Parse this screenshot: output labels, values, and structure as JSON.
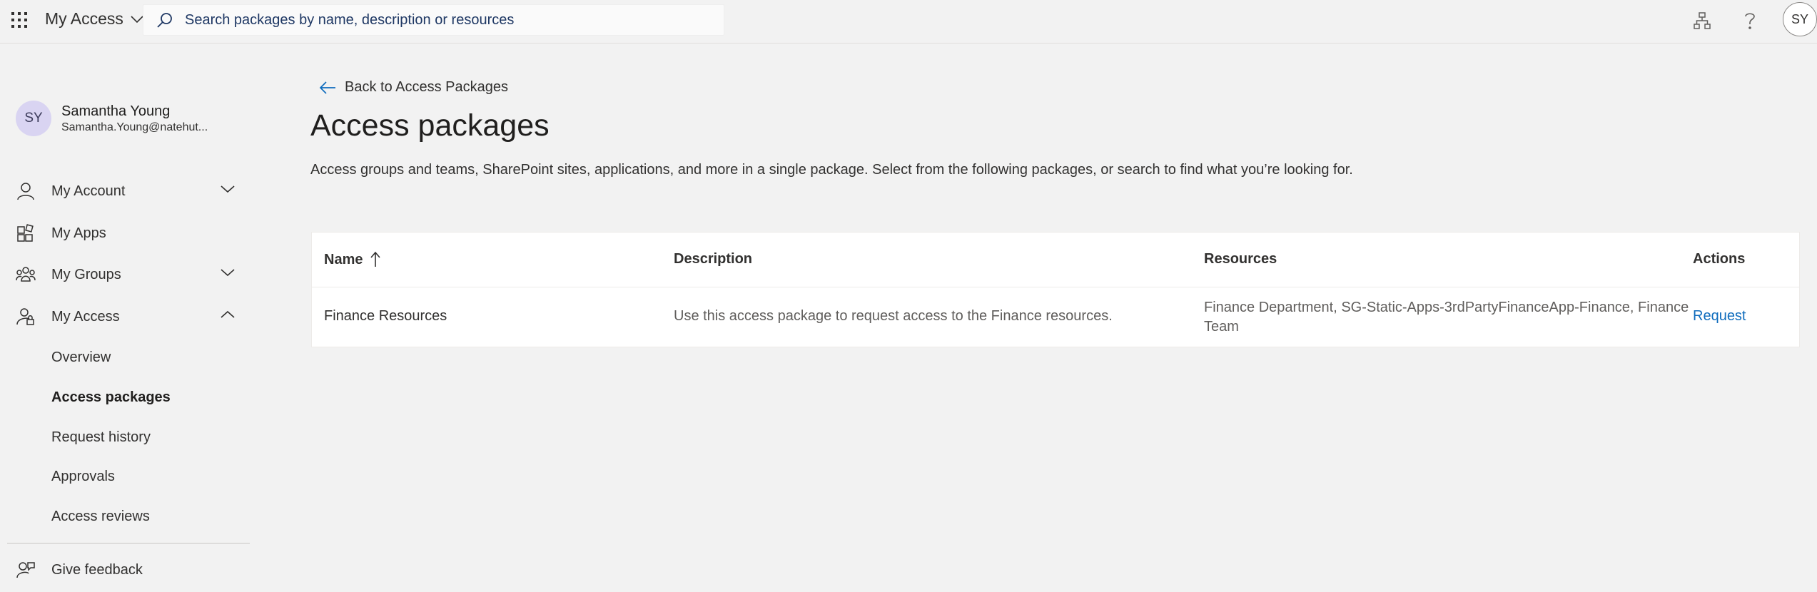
{
  "header": {
    "app_title": "My Access",
    "search_placeholder": "Search packages by name, description or resources",
    "avatar_initials": "SY"
  },
  "profile": {
    "initials": "SY",
    "name": "Samantha Young",
    "email": "Samantha.Young@natehut..."
  },
  "sidebar": {
    "items": [
      {
        "label": "My Account",
        "icon": "person-icon",
        "chevron": "down"
      },
      {
        "label": "My Apps",
        "icon": "apps-icon"
      },
      {
        "label": "My Groups",
        "icon": "groups-icon",
        "chevron": "down"
      },
      {
        "label": "My Access",
        "icon": "lock-person-icon",
        "chevron": "up"
      }
    ],
    "subitems": [
      {
        "label": "Overview"
      },
      {
        "label": "Access packages",
        "active": true
      },
      {
        "label": "Request history"
      },
      {
        "label": "Approvals"
      },
      {
        "label": "Access reviews"
      }
    ],
    "feedback": {
      "label": "Give feedback",
      "icon": "feedback-icon"
    }
  },
  "main": {
    "back_label": "Back to Access Packages",
    "title": "Access packages",
    "description": "Access groups and teams, SharePoint sites, applications, and more in a single package. Select from the following packages, or search to find what you’re looking for."
  },
  "table": {
    "columns": {
      "name": "Name",
      "description": "Description",
      "resources": "Resources",
      "actions": "Actions"
    },
    "rows": [
      {
        "name": "Finance Resources",
        "description": "Use this access package to request access to the Finance resources.",
        "resources_line1": "Finance Department, SG-Static-Apps-3rdPartyFinanceApp-Finance, Finance",
        "resources_line2": "Team",
        "action": "Request"
      }
    ]
  },
  "colors": {
    "background": "#f2f2f2",
    "link": "#0f6cbd",
    "avatar_bg": "#d9d4f2"
  }
}
